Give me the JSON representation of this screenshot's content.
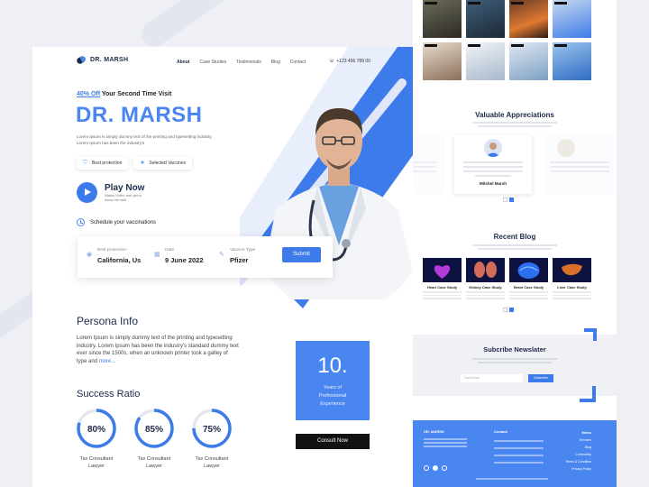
{
  "nav": {
    "logo": "DR. MARSH",
    "links": [
      "About",
      "Case Studies",
      "Testimonials",
      "Blog",
      "Contact"
    ],
    "phone": "+123 456 789 00"
  },
  "hero": {
    "offer_highlight": "40% Off",
    "offer_rest": " Your Second Time Visit",
    "title": "DR. MARSH",
    "description": "Lorem Ipsum is simply dummy text of the printing and typesetting industry. Lorem Ipsum has been the industry's",
    "chips": [
      "Best protection",
      "Selected Vaccines"
    ],
    "play_title": "Play Now",
    "play_sub": "Watch Video and get to know me well",
    "schedule": "Schedule your vaccinations"
  },
  "booking": {
    "fields": [
      {
        "label": "Best protection",
        "value": "California, Us",
        "icon": "location-icon"
      },
      {
        "label": "Date",
        "value": "9 June 2022",
        "icon": "calendar-icon"
      },
      {
        "label": "Vaccine Type",
        "value": "Pfizer",
        "icon": "edit-icon"
      }
    ],
    "submit": "Submit"
  },
  "persona": {
    "title": "Persona Info",
    "text": "Lorem Ipsum is simply dummy text of the printing and typesetting industry. Lorem Ipsum has been the industry's standard dummy text ever since the 1500s, when an unknown printer took a galley of type and ",
    "more": "more..."
  },
  "success": {
    "title": "Success Ratio",
    "rings": [
      {
        "percent": "80%",
        "value": 0.8,
        "label1": "Tax Consultant",
        "label2": "Lawyer"
      },
      {
        "percent": "85%",
        "value": 0.85,
        "label1": "Tax Consultant",
        "label2": "Lawyer"
      },
      {
        "percent": "75%",
        "value": 0.75,
        "label1": "Tax Consultant",
        "label2": "Lawyer"
      }
    ]
  },
  "experience": {
    "number": "10.",
    "line1": "Years of",
    "line2": "Professional",
    "line3": "Experience",
    "consult": "Consult Now"
  },
  "right": {
    "appreciations_title": "Valuable Appreciations",
    "appreciation_name": "Mitchel Marsh",
    "blog_title": "Recent Blog",
    "blogs": [
      "Heart Case Study",
      "Kidney Case Study",
      "Brain Case Study",
      "Liver Case Study"
    ],
    "newsletter_title": "Subcribe Newslater",
    "newsletter_placeholder": "Your Email",
    "newsletter_button": "Subscribe",
    "footer_logo": "DR. MARSH",
    "footer_contact": "Contact",
    "footer_menu": [
      "Menu",
      "Services",
      "Blog",
      "Community",
      "Terms & Condition",
      "Privacy Policy"
    ]
  },
  "colors": {
    "accent": "#3d7bea",
    "dark": "#1e2a4a",
    "footer": "#4a86f0"
  }
}
